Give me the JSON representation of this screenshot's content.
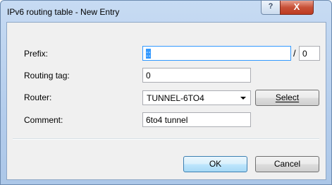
{
  "window": {
    "title": "IPv6 routing table - New Entry",
    "help_glyph": "?",
    "close_glyph": "X"
  },
  "form": {
    "prefix": {
      "label": "Prefix:",
      "value": "::",
      "slash": "/",
      "length": "0"
    },
    "routing_tag": {
      "label": "Routing tag:",
      "value": "0"
    },
    "router": {
      "label": "Router:",
      "value": "TUNNEL-6TO4",
      "select_label": "Select"
    },
    "comment": {
      "label": "Comment:",
      "value": "6to4 tunnel"
    }
  },
  "buttons": {
    "ok": "OK",
    "cancel": "Cancel"
  }
}
